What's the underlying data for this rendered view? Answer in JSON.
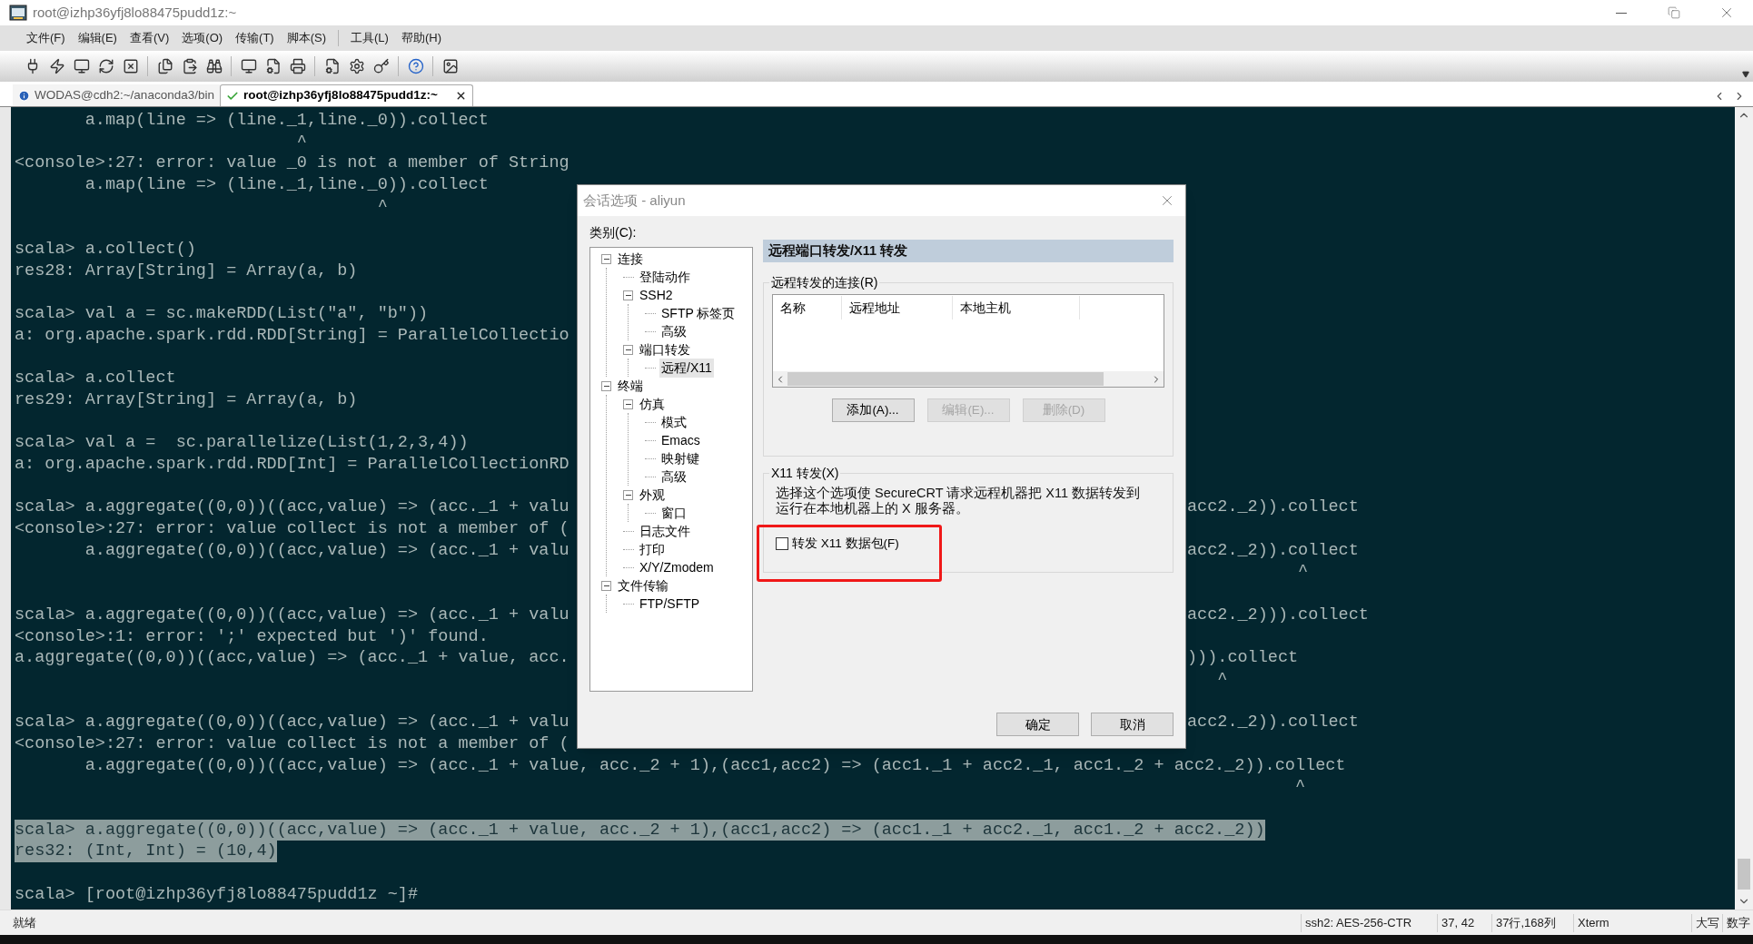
{
  "window": {
    "title": "root@izhp36yfj8lo88475pudd1z:~"
  },
  "menu": [
    "文件(F)",
    "编辑(E)",
    "查看(V)",
    "选项(O)",
    "传输(T)",
    "脚本(S)",
    "工具(L)",
    "帮助(H)"
  ],
  "tabs": [
    {
      "label": "WODAS@cdh2:~/anaconda3/bin",
      "selected": false
    },
    {
      "label": "root@izhp36yfj8lo88475pudd1z:~",
      "selected": true
    }
  ],
  "terminal": {
    "lines": [
      {
        "kind": "plain",
        "text": "       a.map(line => (line._1,line._0)).collect"
      },
      {
        "kind": "plain",
        "text": "                            ^"
      },
      {
        "kind": "plain",
        "text": "<console>:27: error: value _0 is not a member of String"
      },
      {
        "kind": "plain",
        "text": "       a.map(line => (line._1,line._0)).collect"
      },
      {
        "kind": "plain",
        "text": "                                    ^"
      },
      {
        "kind": "blank"
      },
      {
        "kind": "plain",
        "text": "scala> a.collect()"
      },
      {
        "kind": "plain",
        "text": "res28: Array[String] = Array(a, b)"
      },
      {
        "kind": "blank"
      },
      {
        "kind": "plain",
        "text": "scala> val a = sc.makeRDD(List(\"a\", \"b\"))"
      },
      {
        "kind": "plain",
        "text": "a: org.apache.spark.rdd.RDD[String] = ParallelCollectio"
      },
      {
        "kind": "blank"
      },
      {
        "kind": "plain",
        "text": "scala> a.collect"
      },
      {
        "kind": "plain",
        "text": "res29: Array[String] = Array(a, b)"
      },
      {
        "kind": "blank"
      },
      {
        "kind": "plain",
        "text": "scala> val a =  sc.parallelize(List(1,2,3,4))"
      },
      {
        "kind": "plain",
        "text": "a: org.apache.spark.rdd.RDD[Int] = ParallelCollectionRD"
      },
      {
        "kind": "blank"
      },
      {
        "kind": "split",
        "left": "scala> a.aggregate((0,0))((acc,value) => (acc._1 + valu",
        "right": "acc2._2)).collect"
      },
      {
        "kind": "plain",
        "text": "<console>:27: error: value collect is not a member of ("
      },
      {
        "kind": "split",
        "left": "       a.aggregate((0,0))((acc,value) => (acc._1 + valu",
        "right": "acc2._2)).collect"
      },
      {
        "kind": "right_only",
        "right": "           ^"
      },
      {
        "kind": "blank"
      },
      {
        "kind": "split",
        "left": "scala> a.aggregate((0,0))((acc,value) => (acc._1 + valu",
        "right": "acc2._2))).collect"
      },
      {
        "kind": "plain",
        "text": "<console>:1: error: ';' expected but ')' found."
      },
      {
        "kind": "split",
        "left": "a.aggregate((0,0))((acc,value) => (acc._1 + value, acc.",
        "right": "))).collect"
      },
      {
        "kind": "right_only",
        "right": "   ^"
      },
      {
        "kind": "blank"
      },
      {
        "kind": "split",
        "left": "scala> a.aggregate((0,0))((acc,value) => (acc._1 + valu",
        "right": "acc2._2)).collect"
      },
      {
        "kind": "plain",
        "text": "<console>:27: error: value collect is not a member of ("
      },
      {
        "kind": "plain",
        "text": "       a.aggregate((0,0))((acc,value) => (acc._1 + value, acc._2 + 1),(acc1,acc2) => (acc1._1 + acc2._1, acc1._2 + acc2._2)).collect"
      },
      {
        "kind": "plain",
        "text": "                                                                                                                               ^"
      },
      {
        "kind": "blank"
      },
      {
        "kind": "selected",
        "text": "scala> a.aggregate((0,0))((acc,value) => (acc._1 + value, acc._2 + 1),(acc1,acc2) => (acc1._1 + acc2._1, acc1._2 + acc2._2))"
      },
      {
        "kind": "selected",
        "text": "res32: (Int, Int) = (10,4)"
      },
      {
        "kind": "blank"
      },
      {
        "kind": "plain",
        "text": "scala> [root@izhp36yfj8lo88475pudd1z ~]#"
      }
    ]
  },
  "dialog": {
    "title": "会话选项 - aliyun",
    "category_label": "类别(C):",
    "tree": [
      {
        "label": "连接",
        "expanded": true,
        "selected": false,
        "children": [
          {
            "label": "登陆动作",
            "selected": false
          },
          {
            "label": "SSH2",
            "expanded": true,
            "selected": false,
            "children": [
              {
                "label": "SFTP 标签页",
                "selected": false
              },
              {
                "label": "高级",
                "selected": false
              }
            ]
          },
          {
            "label": "端口转发",
            "expanded": true,
            "selected": false,
            "children": [
              {
                "label": "远程/X11",
                "selected": true
              }
            ]
          }
        ]
      },
      {
        "label": "终端",
        "expanded": true,
        "selected": false,
        "children": [
          {
            "label": "仿真",
            "expanded": true,
            "selected": false,
            "children": [
              {
                "label": "模式",
                "selected": false
              },
              {
                "label": "Emacs",
                "selected": false
              },
              {
                "label": "映射键",
                "selected": false
              },
              {
                "label": "高级",
                "selected": false
              }
            ]
          },
          {
            "label": "外观",
            "expanded": true,
            "selected": false,
            "children": [
              {
                "label": "窗口",
                "selected": false
              }
            ]
          },
          {
            "label": "日志文件",
            "selected": false
          },
          {
            "label": "打印",
            "selected": false
          },
          {
            "label": "X/Y/Zmodem",
            "selected": false
          }
        ]
      },
      {
        "label": "文件传输",
        "expanded": true,
        "selected": false,
        "children": [
          {
            "label": "FTP/SFTP",
            "selected": false
          }
        ]
      }
    ],
    "header": "远程端口转发/X11 转发",
    "remote_group": {
      "title": "远程转发的连接(R)",
      "columns": [
        "名称",
        "远程地址",
        "本地主机"
      ],
      "buttons": [
        {
          "label": "添加(A)...",
          "disabled": false
        },
        {
          "label": "编辑(E)...",
          "disabled": true
        },
        {
          "label": "删除(D)",
          "disabled": true
        }
      ]
    },
    "x11_group": {
      "title": "X11 转发(X)",
      "description": "选择这个选项使 SecureCRT 请求远程机器把 X11 数据转发到运行在本地机器上的 X 服务器。",
      "checkbox": {
        "label": "转发 X11 数据包(F)",
        "checked": false
      }
    },
    "buttons": [
      "确定",
      "取消"
    ]
  },
  "status_bar": {
    "message": "就绪",
    "fields": [
      "ssh2: AES-256-CTR",
      "37, 42",
      "37行,168列",
      "Xterm",
      "大写",
      "数字"
    ]
  }
}
